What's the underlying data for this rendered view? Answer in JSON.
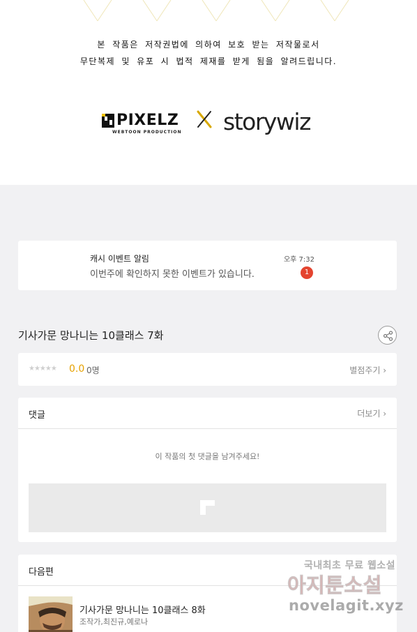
{
  "copyright": {
    "line1": "본 작품은 저작권법에 의하여 보호 받는 저작물로서",
    "line2": "무단복제 및 유포 시 법적 제재를 받게 됨을 알려드립니다."
  },
  "brands": {
    "pixelz_name": "PIXELZ",
    "pixelz_sub": "WEBTOON PRODUCTION",
    "separator": "X",
    "partner_name": "storywiz"
  },
  "notification": {
    "title": "캐시 이벤트 알림",
    "body": "이번주에 확인하지 못한 이벤트가 있습니다.",
    "time": "오후 7:32",
    "badge": "1"
  },
  "episode": {
    "title": "기사가문 망나니는 10클래스 7화"
  },
  "rating": {
    "stars": "★★★★★",
    "score": "0.0",
    "count": "0명",
    "action": "별점주기 ›"
  },
  "comments": {
    "title": "댓글",
    "more": "더보기 ›",
    "empty_message": "이 작품의 첫 댓글을 남겨주세요!"
  },
  "next_episode": {
    "section_title": "다음편",
    "title": "기사가문 망나니는 10클래스 8화",
    "authors": "조작가,최진규,예로나"
  },
  "watermark": {
    "line1": "국내최초 무료 웹소설",
    "line2": "아지툰소설",
    "line3": "novelagit.xyz"
  },
  "colors": {
    "accent_score": "#e6a100",
    "badge": "#e4442f",
    "background": "#f1f1f3"
  },
  "icons": [
    "share-icon",
    "chevron-right-icon",
    "ad-placeholder-icon",
    "x-logo-icon"
  ]
}
